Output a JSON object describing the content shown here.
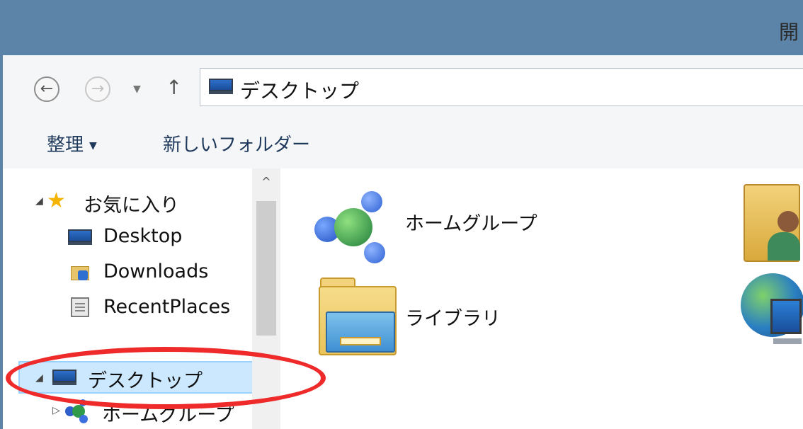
{
  "window": {
    "title_partial": "開"
  },
  "navigation": {
    "back_icon": "back-arrow-icon",
    "forward_icon": "forward-arrow-icon",
    "recent_dropdown_icon": "chevron-down-icon",
    "up_icon": "up-arrow-icon",
    "back_glyph": "←",
    "forward_glyph": "→",
    "dropdown_glyph": "▼",
    "up_glyph": "↑"
  },
  "address_bar": {
    "icon": "desktop-monitor-icon",
    "path": "デスクトップ"
  },
  "toolbar": {
    "organize_label": "整理",
    "organize_arrow": "▼",
    "new_folder_label": "新しいフォルダー"
  },
  "nav_pane": {
    "favorites": {
      "label": "お気に入り",
      "expander": "◢",
      "items": [
        {
          "label": "Desktop",
          "icon": "desktop-monitor-icon"
        },
        {
          "label": "Downloads",
          "icon": "downloads-folder-icon"
        },
        {
          "label": "RecentPlaces",
          "icon": "recent-places-icon"
        }
      ]
    },
    "desktop_node": {
      "label": "デスクトップ",
      "expander": "◢",
      "selected": true
    },
    "homegroup_node": {
      "label": "ホームグループ",
      "expander": "▷"
    },
    "scroll_up_glyph": "^"
  },
  "content": {
    "items": [
      {
        "label": "ホームグループ",
        "icon": "homegroup-icon"
      },
      {
        "label": "ライブラリ",
        "icon": "libraries-folder-icon"
      },
      {
        "label": "",
        "icon": "user-folder-icon"
      },
      {
        "label": "",
        "icon": "network-icon"
      }
    ]
  },
  "annotation": {
    "color": "#ee2a2a",
    "target": "desktop_node"
  }
}
